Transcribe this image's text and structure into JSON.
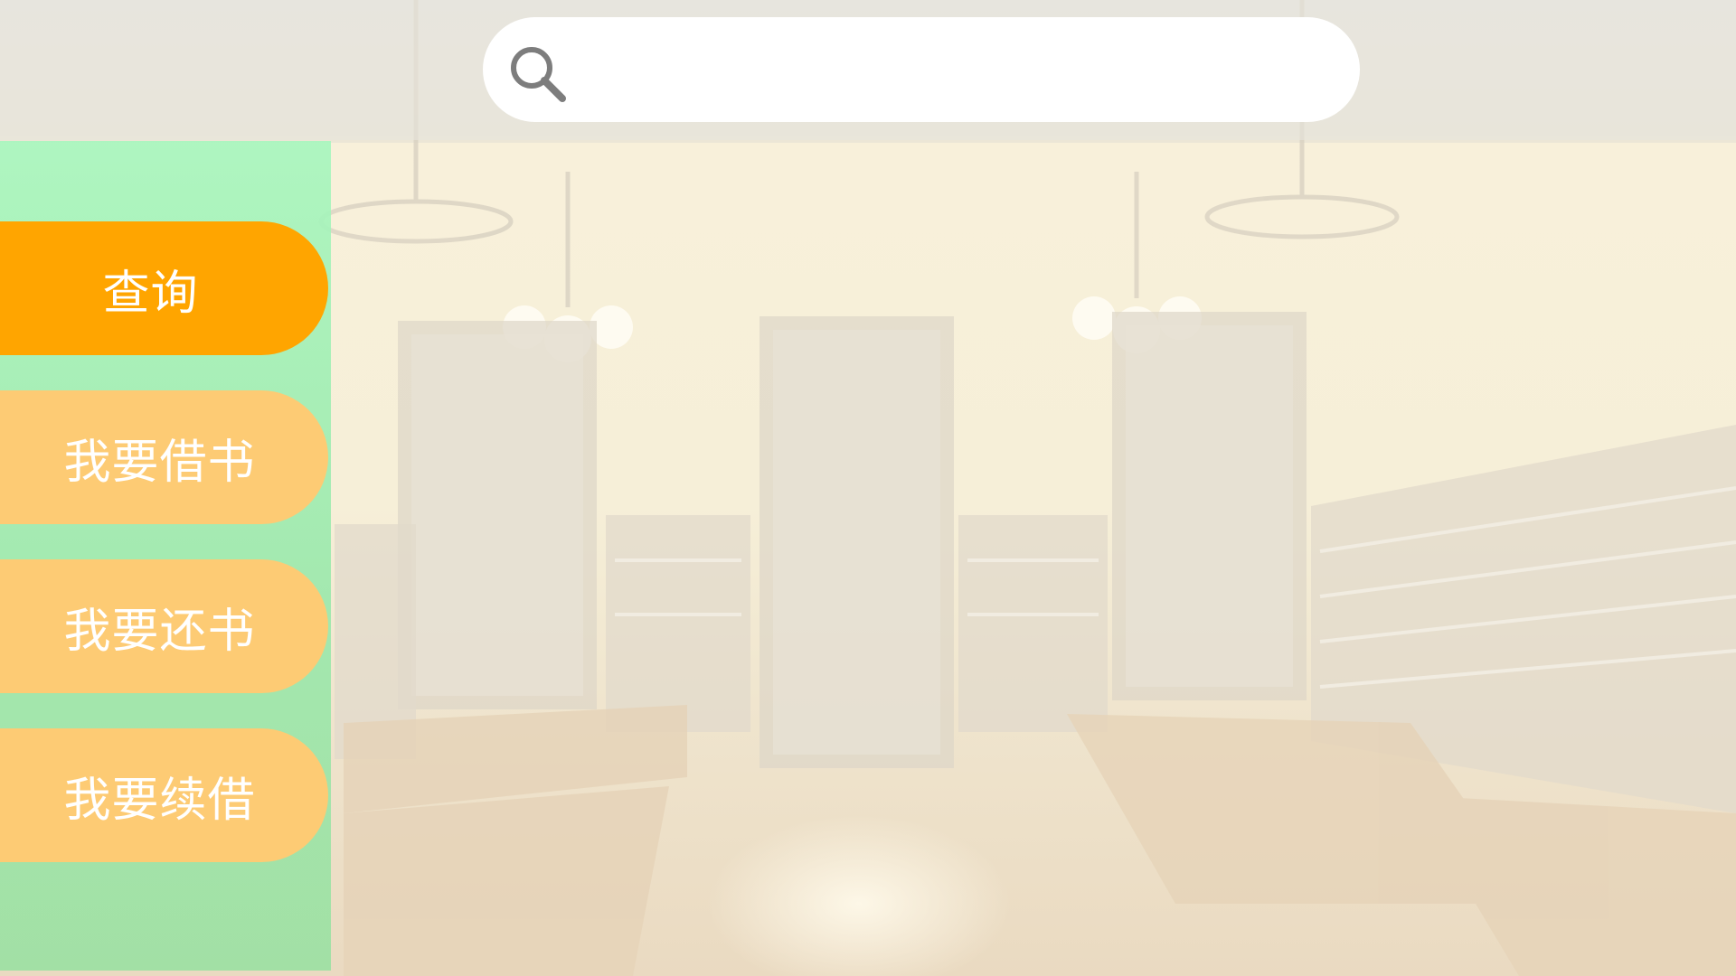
{
  "search": {
    "placeholder": "",
    "value": "",
    "icon": "search-icon"
  },
  "sidebar": {
    "items": [
      {
        "label": "查询",
        "active": true
      },
      {
        "label": "我要借书",
        "active": false
      },
      {
        "label": "我要还书",
        "active": false
      },
      {
        "label": "我要续借",
        "active": false
      }
    ]
  },
  "colors": {
    "active_item": "#ffa500",
    "inactive_item": "#fdcb74",
    "sidebar": "#a8f6be",
    "search_box": "#ffffff"
  }
}
